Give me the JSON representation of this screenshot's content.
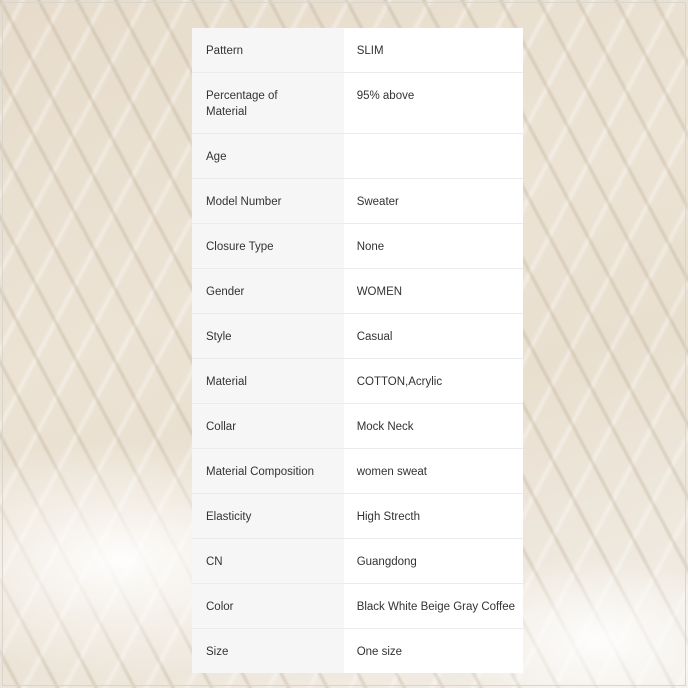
{
  "specs": [
    {
      "label": "Pattern",
      "value": "SLIM"
    },
    {
      "label": "Percentage of Material",
      "value": "95% above"
    },
    {
      "label": "Age",
      "value": ""
    },
    {
      "label": "Model Number",
      "value": "Sweater"
    },
    {
      "label": "Closure Type",
      "value": "None"
    },
    {
      "label": "Gender",
      "value": "WOMEN"
    },
    {
      "label": "Style",
      "value": "Casual"
    },
    {
      "label": "Material",
      "value": "COTTON,Acrylic"
    },
    {
      "label": "Collar",
      "value": "Mock Neck"
    },
    {
      "label": "Material Composition",
      "value": "women sweat"
    },
    {
      "label": "Elasticity",
      "value": "High Strecth"
    },
    {
      "label": "CN",
      "value": "Guangdong"
    },
    {
      "label": "Color",
      "value": "Black White Beige Gray Coffee"
    },
    {
      "label": "Size",
      "value": "One size"
    }
  ]
}
